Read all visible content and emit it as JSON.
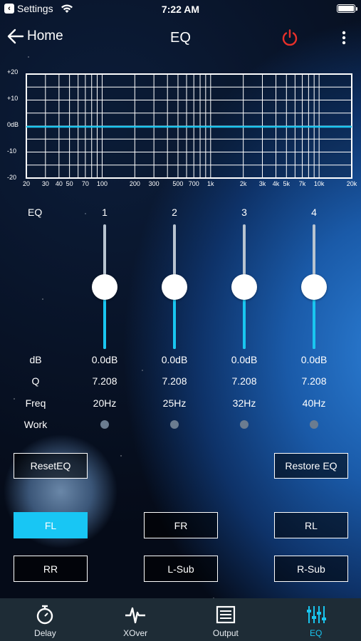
{
  "status_bar": {
    "back_label": "Settings",
    "time": "7:22 AM"
  },
  "nav": {
    "back_label": "Home",
    "title": "EQ",
    "power_color": "#e8302a"
  },
  "graph": {
    "y_labels": [
      "+20",
      "+10",
      "0dB",
      "-10",
      "-20"
    ],
    "x_labels": [
      "20",
      "30",
      "40",
      "50",
      "70",
      "100",
      "200",
      "300",
      "500",
      "700",
      "1k",
      "2k",
      "3k",
      "4k",
      "5k",
      "7k",
      "10k",
      "20k"
    ],
    "curve_color": "#19c6f0"
  },
  "eq_header": "EQ",
  "bands": [
    {
      "number": "1",
      "db": "0.0dB",
      "q": "7.208",
      "freq": "20Hz",
      "level": 0.5
    },
    {
      "number": "2",
      "db": "0.0dB",
      "q": "7.208",
      "freq": "25Hz",
      "level": 0.5
    },
    {
      "number": "3",
      "db": "0.0dB",
      "q": "7.208",
      "freq": "32Hz",
      "level": 0.5
    },
    {
      "number": "4",
      "db": "0.0dB",
      "q": "7.208",
      "freq": "40Hz",
      "level": 0.5
    }
  ],
  "row_labels": {
    "db": "dB",
    "q": "Q",
    "freq": "Freq",
    "work": "Work"
  },
  "buttons": {
    "reset": "ResetEQ",
    "restore": "Restore EQ"
  },
  "channels": [
    {
      "label": "FL",
      "active": true
    },
    {
      "label": "FR",
      "active": false
    },
    {
      "label": "RL",
      "active": false
    },
    {
      "label": "RR",
      "active": false
    },
    {
      "label": "L-Sub",
      "active": false
    },
    {
      "label": "R-Sub",
      "active": false
    }
  ],
  "tabs": [
    {
      "label": "Delay",
      "icon": "stopwatch-icon",
      "active": false
    },
    {
      "label": "XOver",
      "icon": "waveform-icon",
      "active": false
    },
    {
      "label": "Output",
      "icon": "list-icon",
      "active": false
    },
    {
      "label": "EQ",
      "icon": "equalizer-icon",
      "active": true
    }
  ],
  "colors": {
    "accent": "#19c6f0",
    "tabbar": "#1e2c36"
  }
}
